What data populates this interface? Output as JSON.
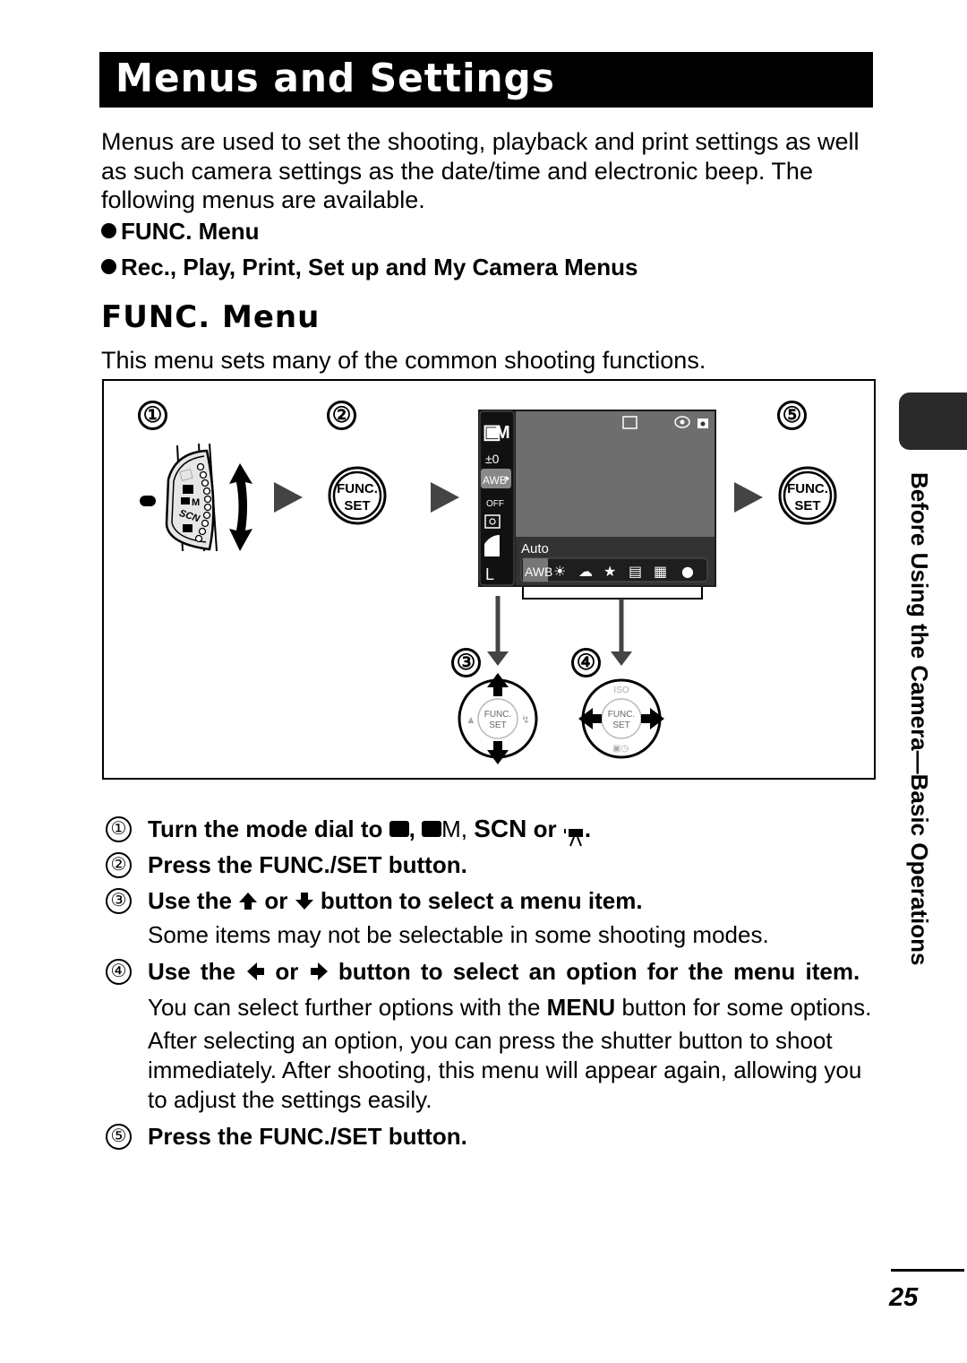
{
  "header": {
    "title": "Menus and Settings"
  },
  "intro": {
    "paragraph": "Menus are used to set the shooting, playback and print settings as well as such camera settings as the date/time and electronic beep. The following menus are available.",
    "bullets": [
      "FUNC. Menu",
      "Rec., Play, Print, Set up and My Camera Menus"
    ]
  },
  "section": {
    "heading": "FUNC. Menu",
    "description": "This menu sets many of the common shooting functions."
  },
  "diagram": {
    "step_numbers": [
      "①",
      "②",
      "③",
      "④",
      "⑤"
    ],
    "func_button_line1": "FUNC.",
    "func_button_line2": "SET",
    "dial_labels": {
      "camera_m": "M",
      "scn": "SCN"
    },
    "lcd": {
      "mode": "M",
      "exposure": "±0",
      "white_balance": "AWB",
      "flash": "OFF",
      "size": "L",
      "selected_option_label": "Auto",
      "option_selected": "AWB"
    },
    "controller_iso": "ISO"
  },
  "steps": [
    {
      "num": "①",
      "title_parts": [
        "Turn the mode dial to",
        ",",
        "M,",
        "SCN",
        "or",
        "."
      ]
    },
    {
      "num": "②",
      "title": "Press the FUNC./SET button."
    },
    {
      "num": "③",
      "title_parts": [
        "Use the",
        "or",
        "button to select a menu item."
      ],
      "body": "Some items may not be selectable in some shooting modes."
    },
    {
      "num": "④",
      "title_parts": [
        "Use the",
        "or",
        "button to select an option for the menu item."
      ],
      "body1_pre": "You can select further options with the ",
      "body1_bold": "MENU",
      "body1_post": " button for some options.",
      "body2": "After selecting an option, you can press the shutter button to shoot immediately. After shooting, this menu will appear again, allowing you to adjust the settings easily."
    },
    {
      "num": "⑤",
      "title": "Press the FUNC./SET button."
    }
  ],
  "side_tab": {
    "label": "Before Using the Camera—Basic Operations"
  },
  "footer": {
    "page_number": "25"
  }
}
